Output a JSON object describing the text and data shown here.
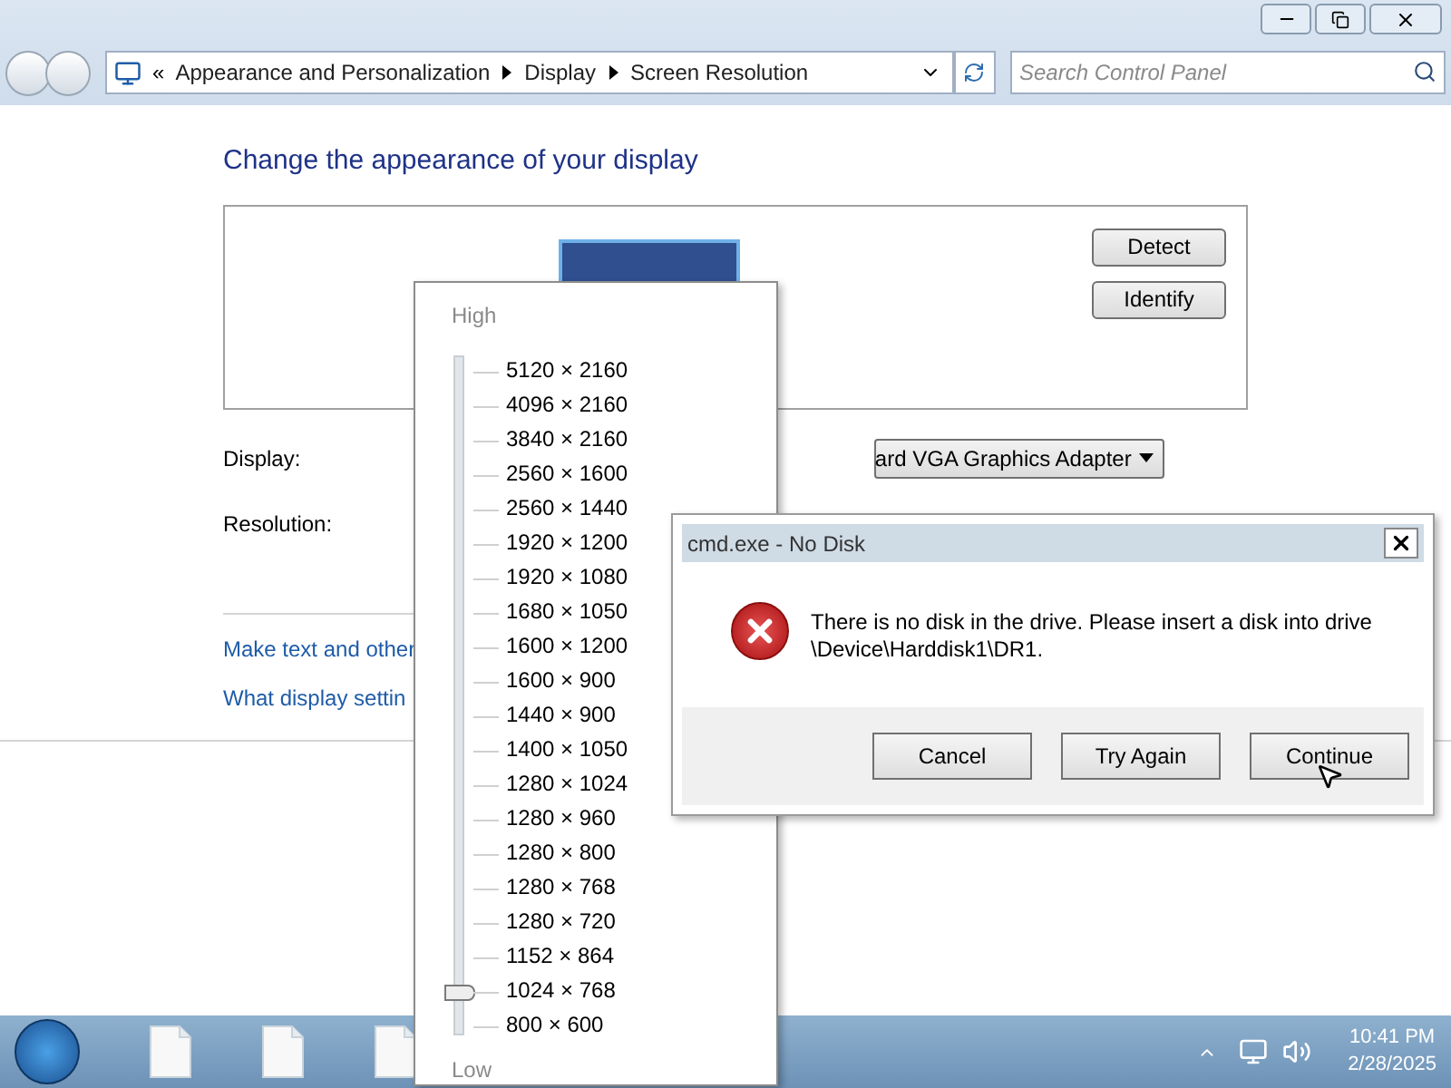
{
  "address_bar": {
    "prefix": "«",
    "crumbs": [
      "Appearance and Personalization",
      "Display",
      "Screen Resolution"
    ]
  },
  "search": {
    "placeholder": "Search Control Panel"
  },
  "heading": "Change the appearance of your display",
  "side_buttons": [
    "Detect",
    "Identify"
  ],
  "fields": [
    {
      "label": "Display:",
      "value": "ard VGA Graphics Adapter"
    },
    {
      "label": "Resolution:"
    }
  ],
  "links": [
    "Make text and other",
    "What display settin"
  ],
  "resolution_popup": {
    "high_label": "High",
    "low_label": "Low",
    "level": 0.05,
    "options": [
      "5120 × 2160",
      "4096 × 2160",
      "3840 × 2160",
      "2560 × 1600",
      "2560 × 1440",
      "1920 × 1200",
      "1920 × 1080",
      "1680 × 1050",
      "1600 × 1200",
      "1600 × 900",
      "1440 × 900",
      "1400 × 1050",
      "1280 × 1024",
      "1280 × 960",
      "1280 × 800",
      "1280 × 768",
      "1280 × 720",
      "1152 × 864",
      "1024 × 768",
      "800 × 600"
    ]
  },
  "dialog": {
    "title": "cmd.exe - No Disk",
    "message": [
      "There is no disk in the drive. Please insert a disk into drive",
      "\\Device\\Harddisk1\\DR1."
    ],
    "buttons": [
      "Cancel",
      "Try Again",
      "Continue"
    ]
  },
  "taskbar": {
    "time": "10:41 PM",
    "date": "2/28/2025"
  }
}
